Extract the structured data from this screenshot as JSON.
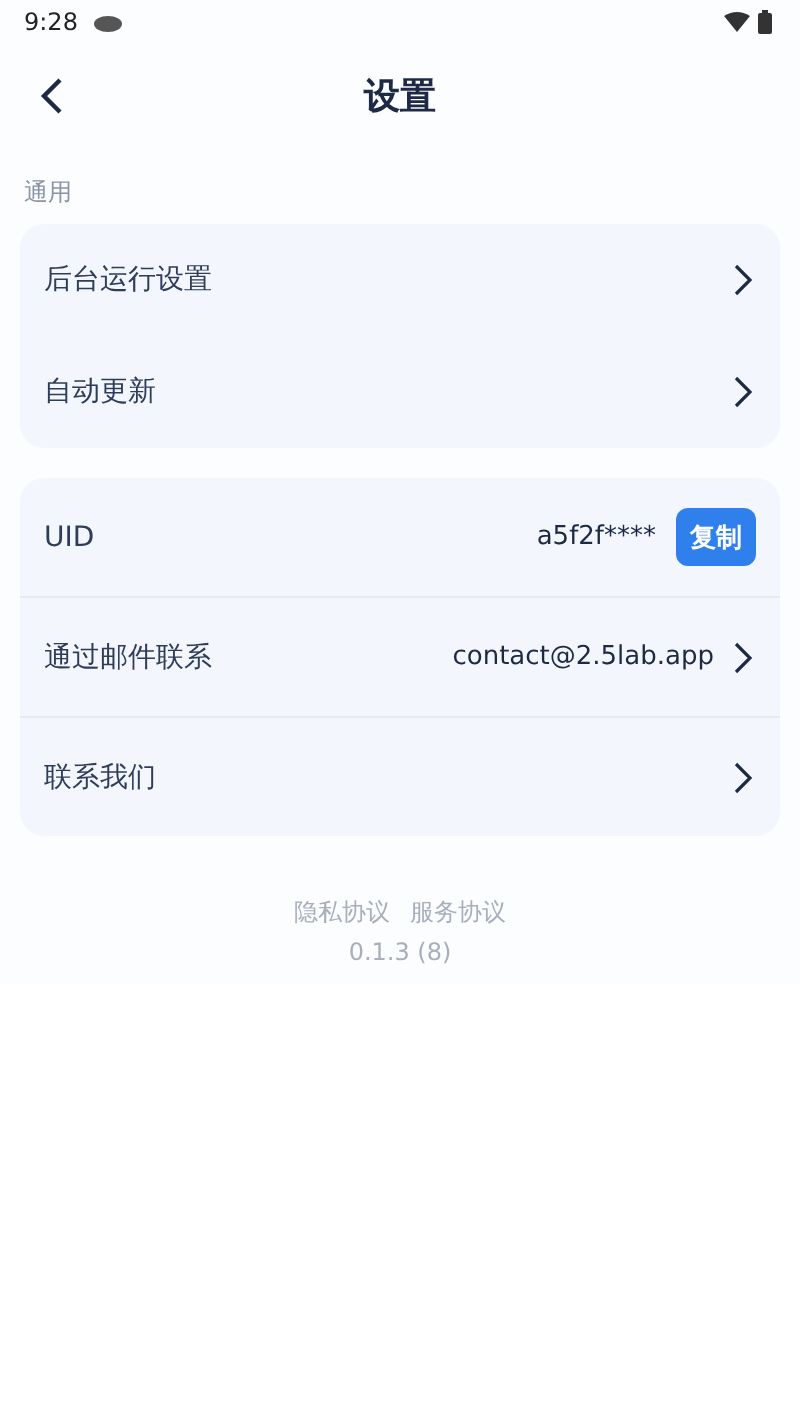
{
  "status_bar": {
    "time": "9:28"
  },
  "header": {
    "title": "设置"
  },
  "sections": [
    {
      "title": "通用",
      "rows": [
        {
          "kind": "link",
          "label": "后台运行设置"
        },
        {
          "kind": "link",
          "label": "自动更新"
        }
      ]
    },
    {
      "rows": [
        {
          "kind": "copy",
          "label": "UID",
          "value": "a5f2f****",
          "button": "复制"
        },
        {
          "kind": "link",
          "label": "通过邮件联系",
          "value": "contact@2.5lab.app"
        },
        {
          "kind": "link",
          "label": "联系我们"
        }
      ]
    }
  ],
  "footer": {
    "links": [
      "隐私协议",
      "服务协议"
    ],
    "version": "0.1.3 (8)"
  }
}
